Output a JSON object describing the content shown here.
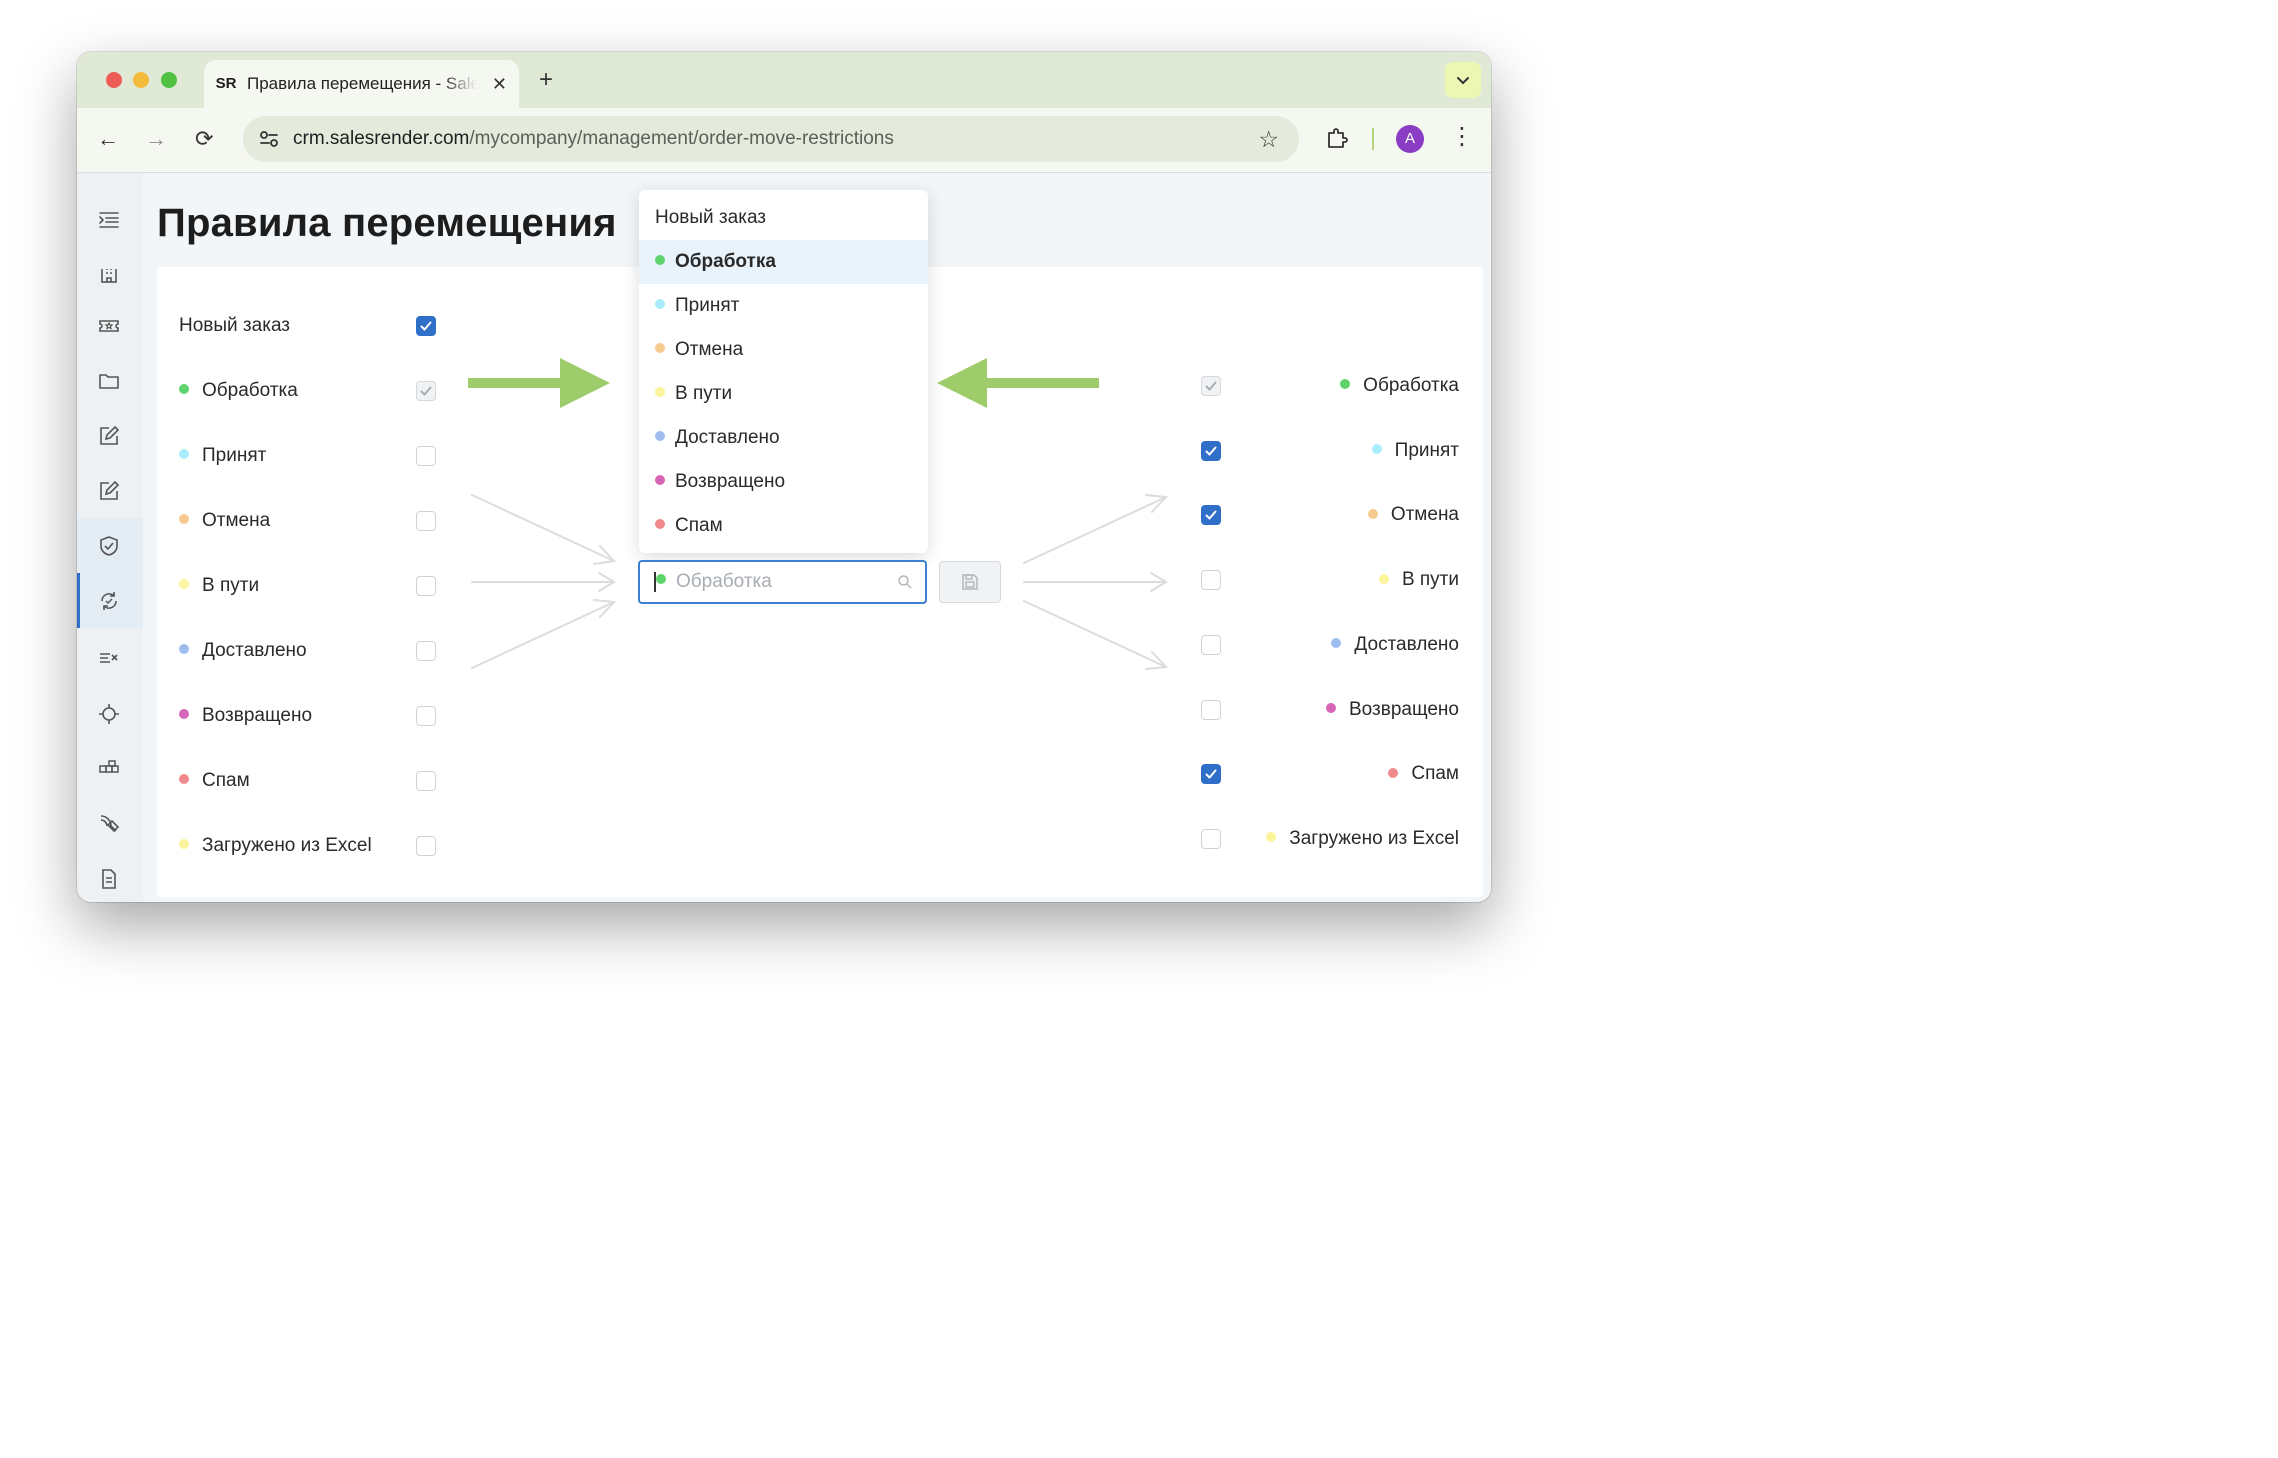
{
  "browser": {
    "tab": {
      "favicon_text": "SR",
      "title": "Правила перемещения - SalesRender",
      "close": "✕"
    },
    "new_tab": "+",
    "tab_menu": "⌄",
    "nav": {
      "back": "←",
      "forward": "→",
      "reload": "⟳"
    },
    "url_host": "crm.salesrender.com",
    "url_path": "/mycompany/management/order-move-restrictions",
    "star": "☆",
    "avatar": "A",
    "menu": "⋮"
  },
  "page": {
    "title": "Правила перемещения"
  },
  "statuses": [
    {
      "label": "Новый заказ",
      "color": ""
    },
    {
      "label": "Обработка",
      "color": "#5fd36b"
    },
    {
      "label": "Принят",
      "color": "#a9ecfb"
    },
    {
      "label": "Отмена",
      "color": "#f6c98f"
    },
    {
      "label": "В пути",
      "color": "#fbf49a"
    },
    {
      "label": "Доставлено",
      "color": "#9ebcf0"
    },
    {
      "label": "Возвращено",
      "color": "#d866b6"
    },
    {
      "label": "Спам",
      "color": "#f08a8a"
    },
    {
      "label": "Загружено из Excel",
      "color": "#fbf49a"
    }
  ],
  "left_list": {
    "items": [
      {
        "label": "Новый заказ",
        "checked": true
      },
      {
        "label": "Обработка",
        "checked": true,
        "disabled": true
      },
      {
        "label": "Принят",
        "checked": false
      },
      {
        "label": "Отмена",
        "checked": false
      },
      {
        "label": "В пути",
        "checked": false
      },
      {
        "label": "Доставлено",
        "checked": false
      },
      {
        "label": "Возвращено",
        "checked": false
      },
      {
        "label": "Спам",
        "checked": false
      },
      {
        "label": "Загружено из Excel",
        "checked": false
      }
    ]
  },
  "right_list": {
    "items": [
      {
        "label": "Обработка",
        "checked": true,
        "disabled": true
      },
      {
        "label": "Принят",
        "checked": true
      },
      {
        "label": "Отмена",
        "checked": true
      },
      {
        "label": "В пути",
        "checked": false
      },
      {
        "label": "Доставлено",
        "checked": false
      },
      {
        "label": "Возвращено",
        "checked": false
      },
      {
        "label": "Спам",
        "checked": true
      },
      {
        "label": "Загружено из Excel",
        "checked": false
      }
    ]
  },
  "dropdown": {
    "options": [
      {
        "label": "Новый заказ"
      },
      {
        "label": "Обработка",
        "selected": true
      },
      {
        "label": "Принят"
      },
      {
        "label": "Отмена"
      },
      {
        "label": "В пути"
      },
      {
        "label": "Доставлено"
      },
      {
        "label": "Возвращено"
      },
      {
        "label": "Спам"
      }
    ]
  },
  "select": {
    "placeholder": "Обработка",
    "dot_color": "#5fd36b"
  },
  "colors": {
    "accent": "#2f6fc8",
    "annotation_arrow": "#9fcc6b",
    "flow_arrow": "#dcdcdc"
  },
  "sidebar_icons": [
    "menu-toggle-icon",
    "building-icon",
    "ticket-icon",
    "folder-icon",
    "edit-icon",
    "edit-icon",
    "shield-check-icon",
    "refresh-cycle-icon",
    "list-x-icon",
    "crosshair-icon",
    "blocks-icon",
    "satellite-icon",
    "document-icon"
  ]
}
